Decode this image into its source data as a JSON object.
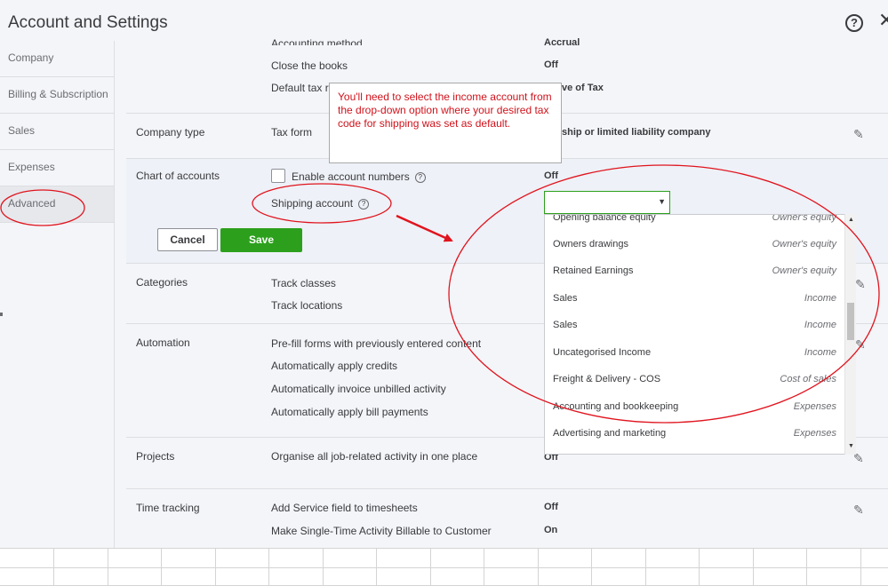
{
  "header": {
    "title": "Account and Settings",
    "help_icon": "?",
    "close_icon": "✕"
  },
  "sidebar": {
    "items": [
      {
        "label": "Company"
      },
      {
        "label": "Billing & Subscription"
      },
      {
        "label": "Sales"
      },
      {
        "label": "Expenses"
      },
      {
        "label": "Advanced"
      }
    ]
  },
  "accounting": {
    "rows": [
      {
        "label": "Accounting method",
        "value": "Accrual"
      },
      {
        "label": "Close the books",
        "value": "Off"
      },
      {
        "label": "Default tax ra",
        "value": "ve of Tax"
      }
    ]
  },
  "company_type": {
    "section": "Company type",
    "label": "Tax form",
    "value": "ship or limited liability company"
  },
  "chart_of_accounts": {
    "section": "Chart of accounts",
    "enable_numbers_label": "Enable account numbers",
    "enable_numbers_value": "Off",
    "shipping_label": "Shipping account",
    "cancel_label": "Cancel",
    "save_label": "Save",
    "selected_value": ""
  },
  "dropdown": {
    "options": [
      {
        "name": "Opening balance equity",
        "type": "Owner's equity"
      },
      {
        "name": "Owners drawings",
        "type": "Owner's equity"
      },
      {
        "name": "Retained Earnings",
        "type": "Owner's equity"
      },
      {
        "name": "Sales",
        "type": "Income"
      },
      {
        "name": "Sales",
        "type": "Income"
      },
      {
        "name": "Uncategorised Income",
        "type": "Income"
      },
      {
        "name": "Freight & Delivery - COS",
        "type": "Cost of sales"
      },
      {
        "name": "Accounting and bookkeeping",
        "type": "Expenses"
      },
      {
        "name": "Advertising and marketing",
        "type": "Expenses"
      }
    ]
  },
  "categories": {
    "section": "Categories",
    "items": [
      "Track classes",
      "Track locations"
    ]
  },
  "automation": {
    "section": "Automation",
    "items": [
      "Pre-fill forms with previously entered content",
      "Automatically apply credits",
      "Automatically invoice unbilled activity",
      "Automatically apply bill payments"
    ]
  },
  "projects": {
    "section": "Projects",
    "label": "Organise all job-related activity in one place",
    "value": "Off"
  },
  "time_tracking": {
    "section": "Time tracking",
    "rows": [
      {
        "label": "Add Service field to timesheets",
        "value": "Off"
      },
      {
        "label": "Make Single-Time Activity Billable to Customer",
        "value": "On"
      }
    ]
  },
  "callout": {
    "text": "You'll need to select the income account from the drop-down option where your desired tax code for shipping was set as default.",
    "color": "#d0121b"
  },
  "icons": {
    "edit": "pencil-icon",
    "help": "question-circle-icon",
    "close": "close-icon"
  },
  "colors": {
    "save_green": "#2ca01c",
    "annotation_red": "#e0141e"
  }
}
